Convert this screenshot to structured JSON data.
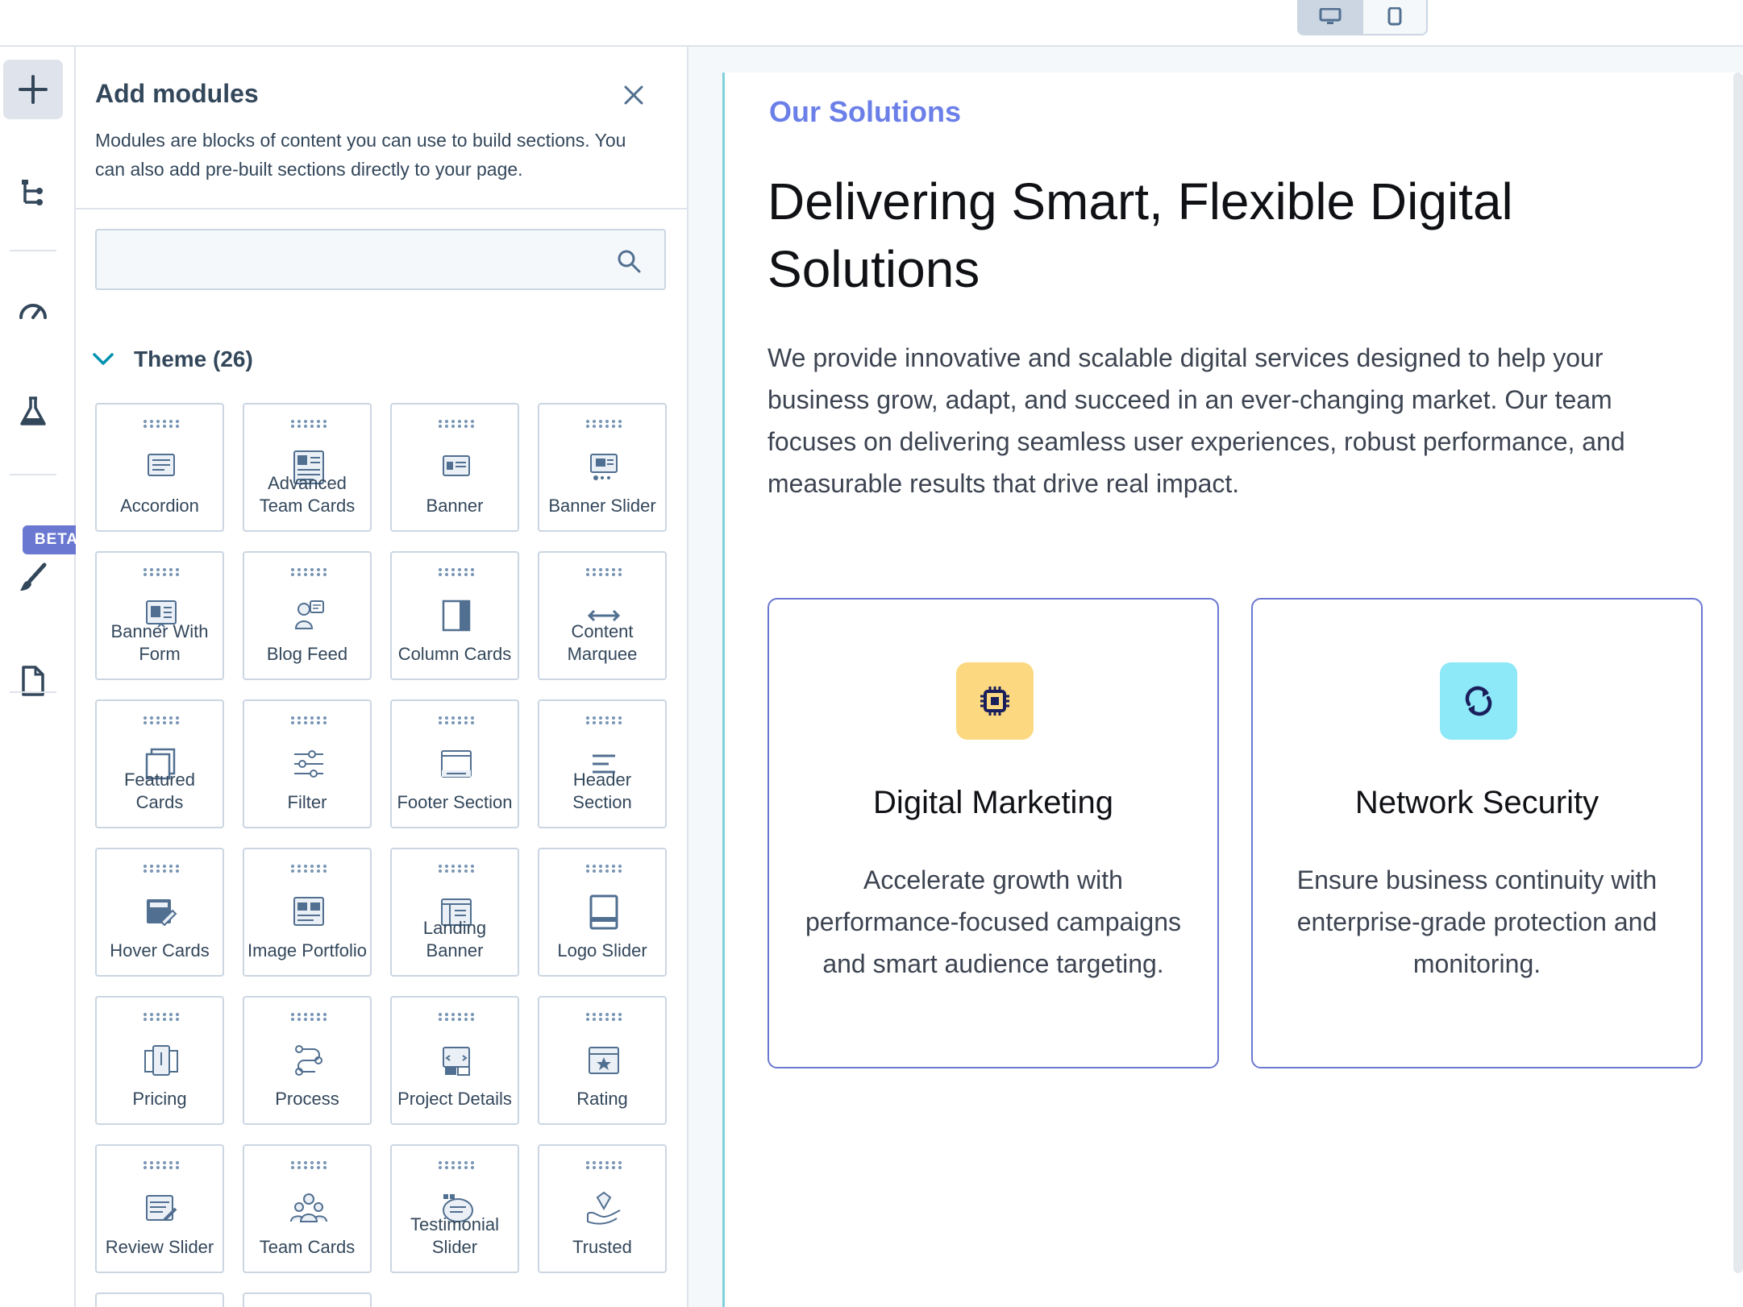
{
  "panel": {
    "title": "Add modules",
    "description": "Modules are blocks of content you can use to build sections. You can also add pre-built sections directly to your page.",
    "search": {
      "value": "",
      "placeholder": ""
    },
    "group": {
      "title": "Theme (26)"
    },
    "modules": [
      {
        "label": "Accordion",
        "icon": "accordion-icon"
      },
      {
        "label": "Advanced Team Cards",
        "icon": "advanced-team-cards-icon"
      },
      {
        "label": "Banner",
        "icon": "banner-icon"
      },
      {
        "label": "Banner Slider",
        "icon": "banner-slider-icon"
      },
      {
        "label": "Banner With Form",
        "icon": "banner-with-form-icon"
      },
      {
        "label": "Blog Feed",
        "icon": "blog-feed-icon"
      },
      {
        "label": "Column Cards",
        "icon": "column-cards-icon"
      },
      {
        "label": "Content Marquee",
        "icon": "content-marquee-icon"
      },
      {
        "label": "Featured Cards",
        "icon": "featured-cards-icon"
      },
      {
        "label": "Filter",
        "icon": "filter-icon"
      },
      {
        "label": "Footer Section",
        "icon": "footer-section-icon"
      },
      {
        "label": "Header Section",
        "icon": "header-section-icon"
      },
      {
        "label": "Hover Cards",
        "icon": "hover-cards-icon"
      },
      {
        "label": "Image Portfolio",
        "icon": "image-portfolio-icon"
      },
      {
        "label": "Landing Banner",
        "icon": "landing-banner-icon"
      },
      {
        "label": "Logo Slider",
        "icon": "logo-slider-icon"
      },
      {
        "label": "Pricing",
        "icon": "pricing-icon"
      },
      {
        "label": "Process",
        "icon": "process-icon"
      },
      {
        "label": "Project Details",
        "icon": "project-details-icon"
      },
      {
        "label": "Rating",
        "icon": "rating-icon"
      },
      {
        "label": "Review Slider",
        "icon": "review-slider-icon"
      },
      {
        "label": "Team Cards",
        "icon": "team-cards-icon"
      },
      {
        "label": "Testimonial Slider",
        "icon": "testimonial-slider-icon"
      },
      {
        "label": "Trusted",
        "icon": "trusted-icon"
      }
    ]
  },
  "rail": {
    "beta_label": "BETA",
    "icons": [
      "plus-icon",
      "tree-icon",
      "gauge-icon",
      "flask-icon",
      "brush-icon",
      "page-icon"
    ]
  },
  "preview": {
    "kicker": "Our Solutions",
    "headline": "Delivering Smart, Flexible Digital Solutions",
    "intro": "We provide innovative and scalable digital services designed to help your business grow, adapt, and succeed in an ever-changing market. Our team focuses on delivering seamless user experiences, robust performance, and measurable results that drive real impact.",
    "features": [
      {
        "title": "Digital Marketing",
        "text": "Accelerate growth with performance-focused campaigns and smart audience targeting.",
        "icon": "chip-icon",
        "icon_bg": "#fcd980"
      },
      {
        "title": "Network Security",
        "text": "Ensure business continuity with enterprise-grade protection and monitoring.",
        "icon": "refresh-icon",
        "icon_bg": "#8de8f8"
      }
    ]
  },
  "colors": {
    "accent": "#6a78d1",
    "kicker": "#6b7fe8",
    "border": "#cbd6e2",
    "text": "#33475b"
  }
}
